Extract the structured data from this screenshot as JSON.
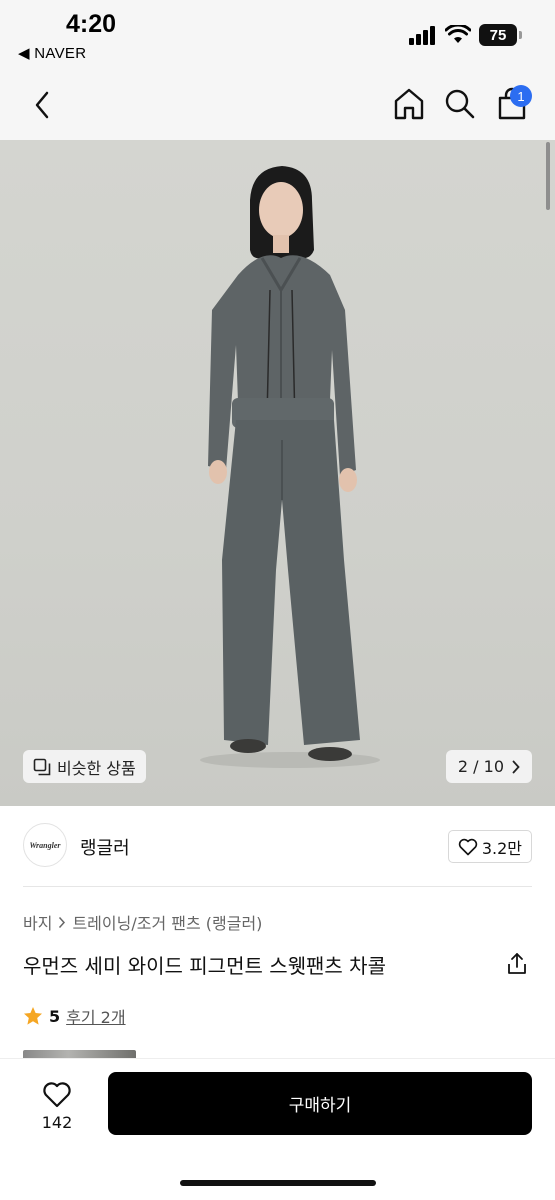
{
  "status_bar": {
    "time": "4:20",
    "back_app": "◀ NAVER",
    "battery": "75"
  },
  "nav": {
    "cart_badge": "1"
  },
  "image": {
    "similar_label": "비슷한 상품",
    "page_counter": "2 / 10"
  },
  "brand": {
    "logo_text": "Wrangler",
    "name": "랭글러",
    "like_count": "3.2만"
  },
  "product": {
    "breadcrumb": [
      "바지",
      "트레이닝/조거 팬츠 (랭글러)"
    ],
    "title": "우먼즈 세미 와이드 피그먼트 스웻팬츠 차콜",
    "rating": "5",
    "review_link": "후기 2개"
  },
  "bottom": {
    "wish_count": "142",
    "buy_label": "구매하기"
  },
  "colors": {
    "accent_badge": "#2c6df1",
    "buy_button": "#000000",
    "star": "#f5a623",
    "garment": "#5e6466"
  },
  "icons": [
    "back-arrow-icon",
    "home-icon",
    "search-icon",
    "cart-icon",
    "share-icon",
    "heart-icon",
    "star-icon",
    "similar-icon",
    "chevron-right-icon"
  ]
}
